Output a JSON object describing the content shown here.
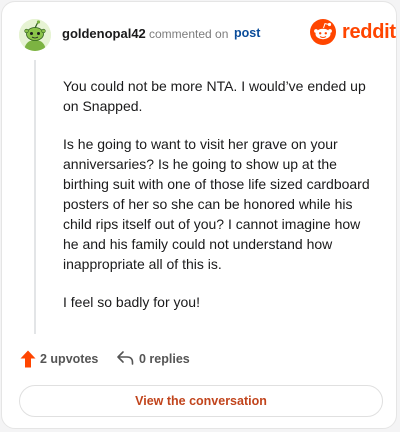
{
  "header": {
    "username": "goldenopal42",
    "action_text": "commented on",
    "post_link": "post",
    "brand": "reddit",
    "brand_color": "#ff4500",
    "avatar_icon": "snoo-avatar-icon"
  },
  "comment": {
    "paragraphs": [
      "You could not be more NTA. I would’ve ended up on Snapped.",
      "Is he going to want to visit her grave on your anniversaries? Is he going to show up at the birthing suit with one of those life sized cardboard posters of her so she can be honored while his child rips itself out of you? I cannot imagine how he and his family could not understand how inappropriate all of this is.",
      "I feel so badly for you!"
    ]
  },
  "actions": {
    "upvotes": "2 upvotes",
    "upvote_icon": "upvote-arrow-icon",
    "upvote_color": "#ff4500",
    "replies": "0 replies",
    "reply_icon": "reply-arrow-icon"
  },
  "footer": {
    "view_button": "View the conversation",
    "view_button_color": "#c1441c"
  }
}
